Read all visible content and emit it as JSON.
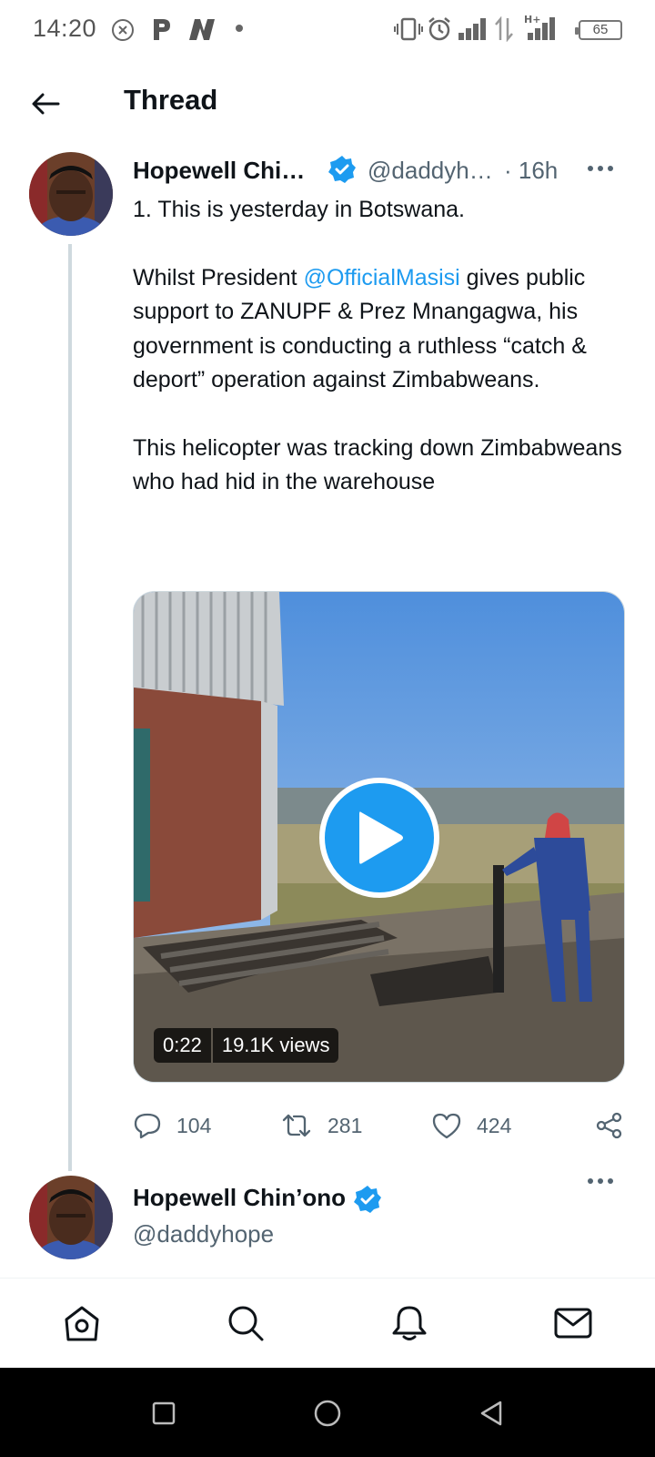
{
  "status_bar": {
    "time": "14:20",
    "battery": "65",
    "icons": [
      "close-circle-icon",
      "p-notification-icon",
      "n-notification-icon",
      "dot-icon",
      "vibrate-icon",
      "alarm-icon",
      "signal-icon",
      "data-arrows-icon",
      "h-plus-signal-icon",
      "battery-icon"
    ]
  },
  "header": {
    "title": "Thread",
    "back_icon": "arrow-left-icon"
  },
  "tweet": {
    "name": "Hopewell Chi…",
    "handle": "@daddyh…",
    "time": "· 16h",
    "paragraphs": {
      "p1": "1. This is yesterday in Botswana.",
      "p2_before": "Whilst President ",
      "p2_mention": "@OfficialMasisi",
      "p2_after": " gives public support to ZANUPF & Prez Mnangagwa, his government is conducting a ruthless “catch & deport” operation against Zimbabweans.",
      "p3": "This helicopter was tracking down Zimbabweans who had hid in the warehouse"
    },
    "media": {
      "duration": "0:22",
      "views": "19.1K views"
    },
    "actions": {
      "replies": "104",
      "retweets": "281",
      "likes": "424"
    }
  },
  "next_tweet": {
    "name": "Hopewell Chin’ono",
    "handle": "@daddyhope"
  },
  "bottom_nav": [
    "home-icon",
    "search-icon",
    "notifications-icon",
    "messages-icon"
  ],
  "colors": {
    "accent": "#1d9bf0",
    "text": "#0f1419",
    "secondary": "#536471",
    "divider": "#cfd9de"
  }
}
